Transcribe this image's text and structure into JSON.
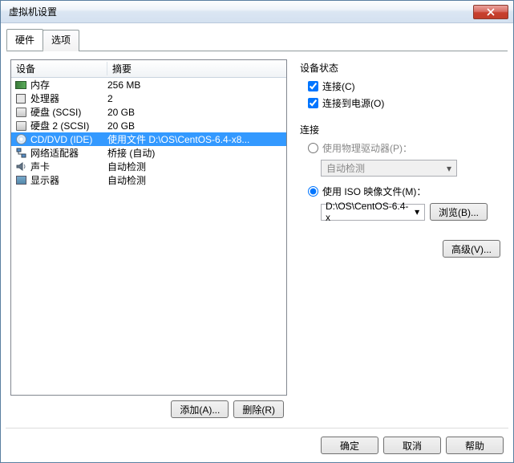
{
  "window_title": "虚拟机设置",
  "tabs": {
    "hardware": "硬件",
    "options": "选项"
  },
  "columns": {
    "device": "设备",
    "summary": "摘要"
  },
  "devices": [
    {
      "name": "内存",
      "summary": "256 MB",
      "icon": "memory"
    },
    {
      "name": "处理器",
      "summary": "2",
      "icon": "cpu"
    },
    {
      "name": "硬盘 (SCSI)",
      "summary": "20 GB",
      "icon": "disk"
    },
    {
      "name": "硬盘 2 (SCSI)",
      "summary": "20 GB",
      "icon": "disk"
    },
    {
      "name": "CD/DVD (IDE)",
      "summary": "使用文件 D:\\OS\\CentOS-6.4-x8...",
      "icon": "cd",
      "selected": true
    },
    {
      "name": "网络适配器",
      "summary": "桥接 (自动)",
      "icon": "net"
    },
    {
      "name": "声卡",
      "summary": "自动检测",
      "icon": "sound"
    },
    {
      "name": "显示器",
      "summary": "自动检测",
      "icon": "display"
    }
  ],
  "status_group": {
    "title": "设备状态",
    "connected_label": "连接(C)",
    "connected_checked": true,
    "poweron_label": "连接到电源(O)",
    "poweron_checked": true
  },
  "connection_group": {
    "title": "连接",
    "physical_label": "使用物理驱动器(P)：",
    "physical_dropdown": "自动检测",
    "iso_label": "使用 ISO 映像文件(M)：",
    "iso_value": "D:\\OS\\CentOS-6.4-x",
    "browse_label": "浏览(B)..."
  },
  "advanced_label": "高级(V)...",
  "buttons": {
    "add": "添加(A)...",
    "remove": "删除(R)",
    "ok": "确定",
    "cancel": "取消",
    "help": "帮助"
  }
}
